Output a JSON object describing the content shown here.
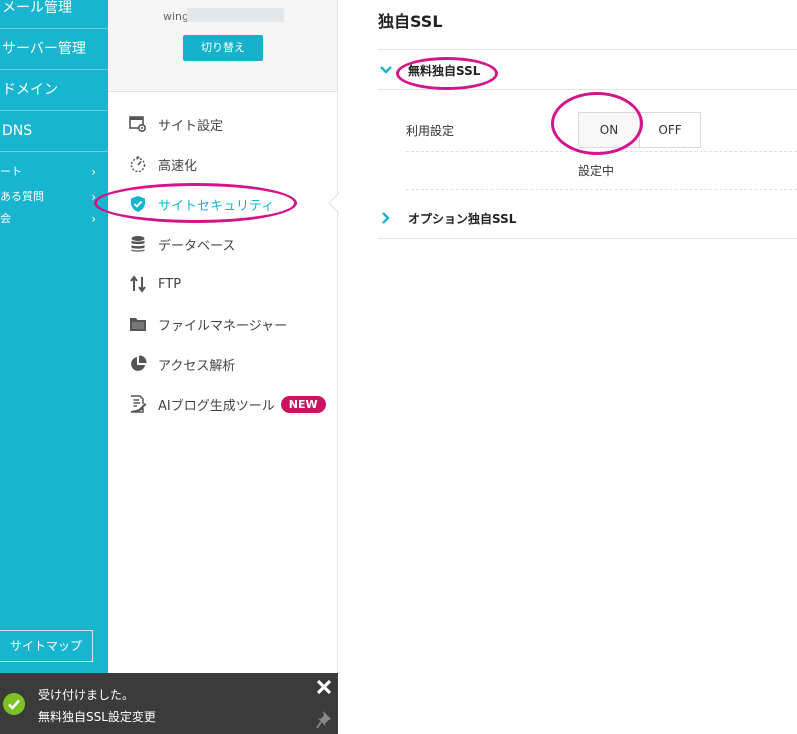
{
  "leftnav": {
    "items": [
      {
        "label": "メール管理"
      },
      {
        "label": "サーバー管理"
      },
      {
        "label": "ドメイン"
      },
      {
        "label": "DNS"
      }
    ],
    "subitems": [
      {
        "label": "ート"
      },
      {
        "label": "ある質問"
      },
      {
        "label": "会"
      }
    ],
    "sitemap_label": "サイトマップ"
  },
  "account": {
    "server_prefix": "wing",
    "switch_label": "切り替え"
  },
  "menu": {
    "items": [
      {
        "label": "サイト設定",
        "icon": "site-settings-icon"
      },
      {
        "label": "高速化",
        "icon": "speed-icon"
      },
      {
        "label": "サイトセキュリティ",
        "icon": "shield-check-icon",
        "active": true
      },
      {
        "label": "データベース",
        "icon": "database-icon"
      },
      {
        "label": "FTP",
        "icon": "transfer-arrows-icon"
      },
      {
        "label": "ファイルマネージャー",
        "icon": "folder-icon"
      },
      {
        "label": "アクセス解析",
        "icon": "pie-chart-icon"
      },
      {
        "label": "AIブログ生成ツール",
        "icon": "document-edit-icon",
        "badge": "NEW"
      }
    ]
  },
  "main": {
    "title": "独自SSL",
    "section1": {
      "label": "無料独自SSL",
      "row_label": "利用設定",
      "toggle_on": "ON",
      "toggle_off": "OFF",
      "status": "設定中"
    },
    "section2": {
      "label": "オプション独自SSL"
    }
  },
  "toast": {
    "line1": "受け付けました。",
    "line2": "無料独自SSL設定変更"
  },
  "colors": {
    "teal": "#17b5cf",
    "highlight": "#d4148a",
    "badge": "#c8155f",
    "success": "#7cc223",
    "toast_bg": "#3b3b3b"
  }
}
